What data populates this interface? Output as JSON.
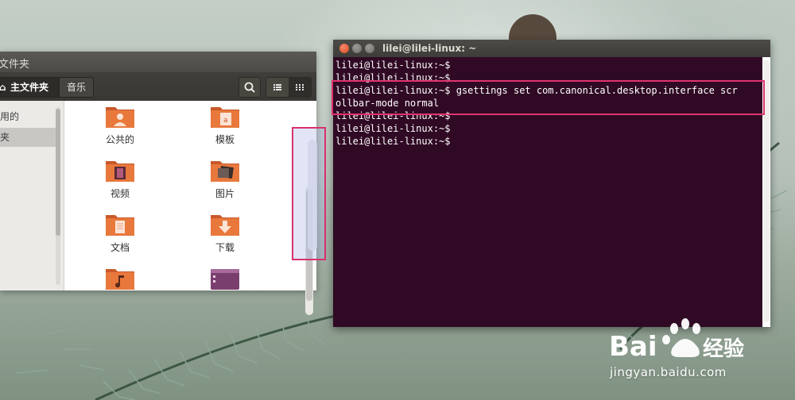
{
  "file_manager": {
    "window_title": "文件夹",
    "home_label": "主文件夹",
    "home_icon": "home-icon",
    "music_label": "音乐",
    "sidebar": [
      {
        "label": "用的",
        "selected": false
      },
      {
        "label": "夹",
        "selected": true
      }
    ],
    "items": [
      {
        "label": "公共的",
        "icon": "folder-public-icon"
      },
      {
        "label": "模板",
        "icon": "folder-templates-icon"
      },
      {
        "label": "视频",
        "icon": "folder-videos-icon"
      },
      {
        "label": "图片",
        "icon": "folder-pictures-icon"
      },
      {
        "label": "文档",
        "icon": "folder-documents-icon"
      },
      {
        "label": "下载",
        "icon": "folder-download-icon"
      },
      {
        "label": "",
        "icon": "folder-music-icon"
      },
      {
        "label": "",
        "icon": "ubuntu-desktop-icon"
      }
    ]
  },
  "terminal": {
    "title": "lilei@lilei-linux: ~",
    "lines": [
      "lilei@lilei-linux:~$",
      "lilei@lilei-linux:~$",
      "lilei@lilei-linux:~$ gsettings set com.canonical.desktop.interface scr",
      "ollbar-mode normal",
      "lilei@lilei-linux:~$",
      "lilei@lilei-linux:~$",
      "lilei@lilei-linux:~$"
    ]
  },
  "watermark": {
    "brand": "Baidu经验",
    "site": "jingyan.baidu.com"
  },
  "colors": {
    "terminal_bg": "#300a24",
    "folder_orange": "#e8783c",
    "highlight": "#e0336e"
  }
}
